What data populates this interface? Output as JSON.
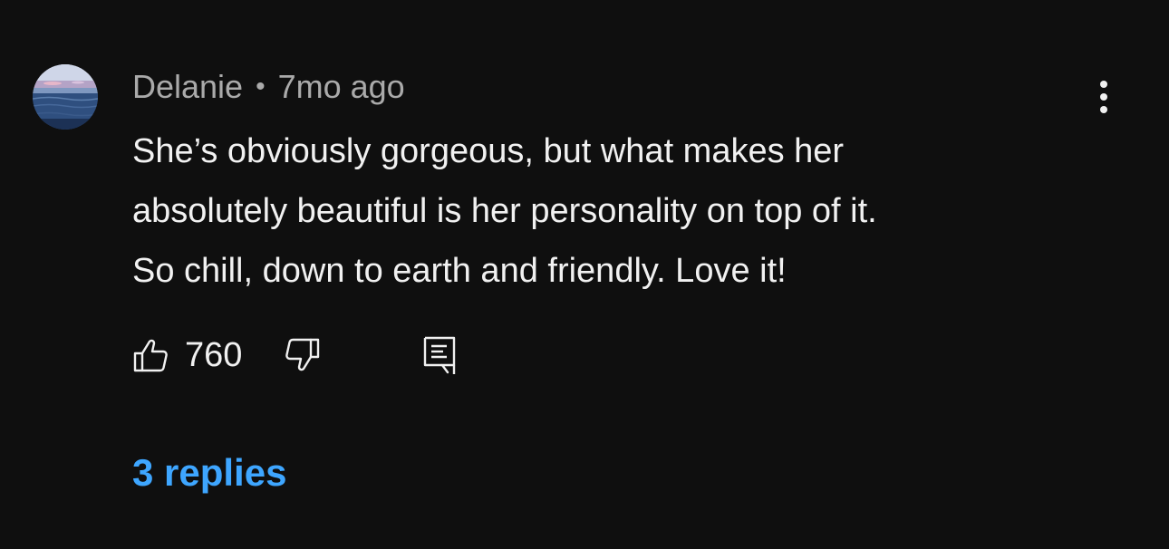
{
  "comment": {
    "author": "Delanie",
    "separator": "•",
    "timestamp": "7mo ago",
    "avatar_icon": "ocean-sunset-avatar",
    "text_lines": [
      "She’s obviously gorgeous, but what makes her",
      "absolutely beautiful is her personality on top of it.",
      "So chill, down to earth and friendly. Love it!"
    ],
    "like_count": "760",
    "replies_label": "3 replies"
  },
  "icons": {
    "like": "thumbs-up-icon",
    "dislike": "thumbs-down-icon",
    "reply": "comment-reply-icon",
    "more": "more-vertical-icon"
  },
  "colors": {
    "background": "#0f0f0f",
    "text_primary": "#f1f1f1",
    "text_secondary": "#aaaaaa",
    "link": "#3ea6ff"
  }
}
